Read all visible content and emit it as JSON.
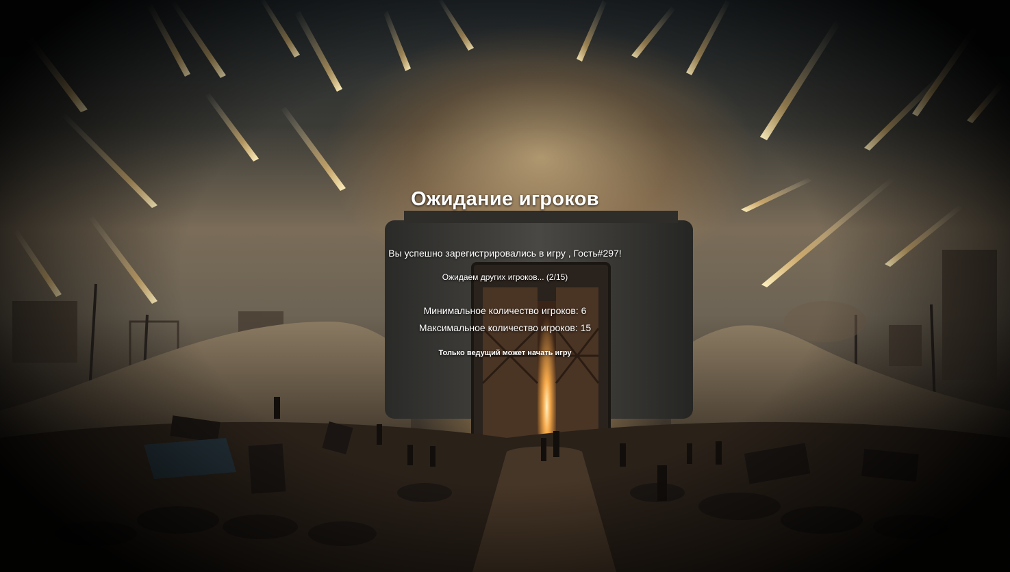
{
  "lobby": {
    "title": "Ожидание игроков",
    "registered_message": "Вы успешно зарегистрировались в игру , Гость#297!",
    "waiting_message": "Ожидаем других игроков... (2/15)",
    "min_players": "Минимальное количество игроков: 6",
    "max_players": "Максимальное количество игроков: 15",
    "host_notice": "Только ведущий может начать игру"
  },
  "background": {
    "description_icon": "apocalypse-bunker-background",
    "colors": {
      "sky_dark": "#232a2e",
      "glow": "#ffd696",
      "ground": "#2a241e"
    }
  }
}
